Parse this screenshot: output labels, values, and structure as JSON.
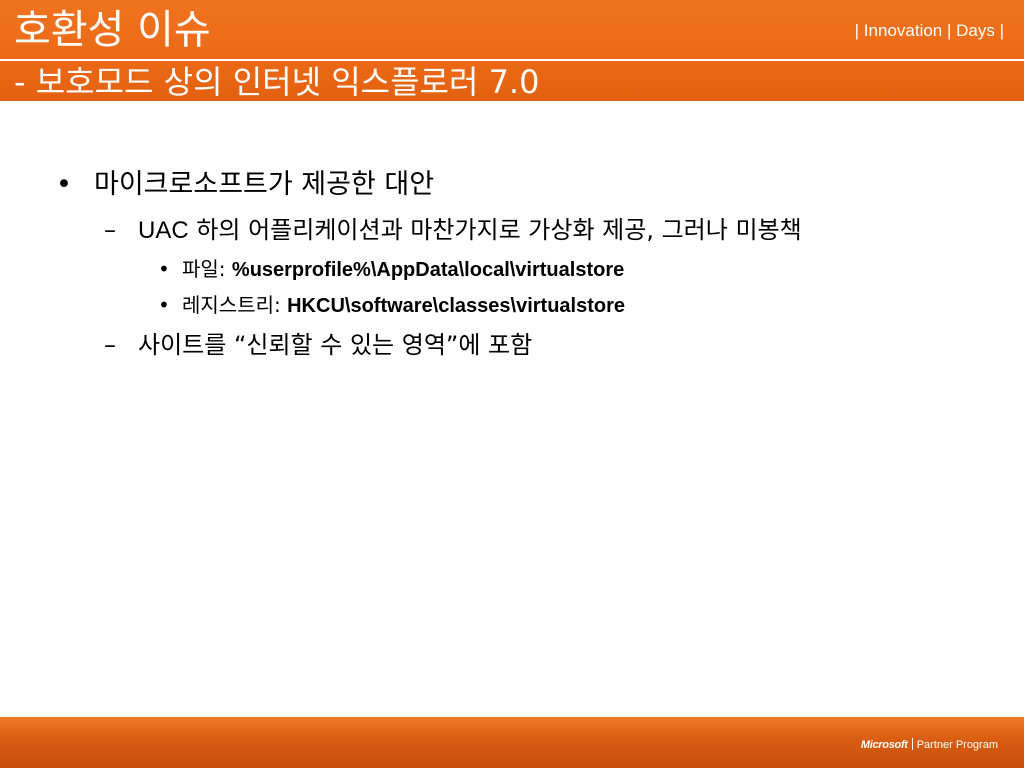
{
  "header": {
    "title": "호환성 이슈",
    "subtitle": "- 보호모드 상의 인터넷 익스플로러 7.0",
    "brand": "| Innovation | Days |"
  },
  "bullets": [
    {
      "level": 1,
      "marker": "•",
      "text": "마이크로소프트가 제공한 대안"
    },
    {
      "level": 2,
      "marker": "–",
      "prefix": "UAC",
      "text": " 하의 어플리케이션과 마찬가지로 가상화 제공, 그러나 미봉책"
    },
    {
      "level": 3,
      "marker": "•",
      "label": "파일: ",
      "path": "%userprofile%\\AppData\\local\\virtualstore"
    },
    {
      "level": 3,
      "marker": "•",
      "label": "레지스트리: ",
      "path": "HKCU\\software\\classes\\virtualstore"
    },
    {
      "level": 2,
      "marker": "–",
      "text": "사이트를 “신뢰할 수 있는 영역”에 포함"
    }
  ],
  "footer": {
    "company": "Microsoft",
    "program": "Partner Program"
  },
  "colors": {
    "header_orange": "#ec6a17",
    "footer_orange": "#d95d12",
    "text": "#000000",
    "header_text": "#ffffff"
  }
}
